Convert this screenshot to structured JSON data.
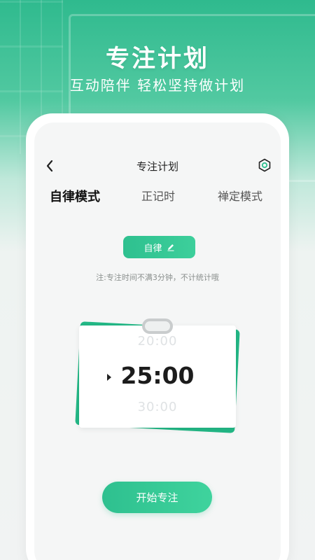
{
  "hero": {
    "title": "专注计划",
    "subtitle": "互动陪伴 轻松坚持做计划"
  },
  "nav": {
    "title": "专注计划",
    "back_icon": "chevron-left-icon",
    "settings_icon": "hexagon-gear-icon"
  },
  "tabs": [
    {
      "label": "自律模式",
      "active": true
    },
    {
      "label": "正记时",
      "active": false
    },
    {
      "label": "禅定模式",
      "active": false
    }
  ],
  "mode_button": {
    "label": "自律",
    "icon": "pencil-icon"
  },
  "note": "注:专注时间不满3分钟，不计统计哦",
  "timer": {
    "previous": "20:00",
    "current": "25:00",
    "next": "30:00"
  },
  "start_button": {
    "label": "开始专注"
  },
  "colors": {
    "accent": "#2ec08f",
    "background": "#f5f6f6"
  }
}
